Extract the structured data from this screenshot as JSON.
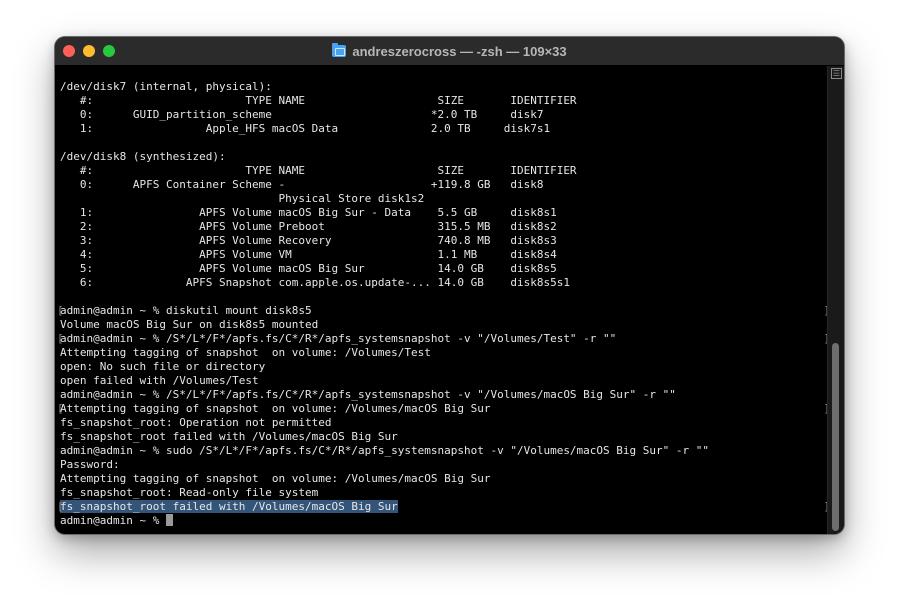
{
  "window": {
    "title": "andreszerocross — -zsh — 109×33"
  },
  "terminal": {
    "lines": [
      {
        "text": "",
        "bracket": false,
        "highlight": false
      },
      {
        "text": "/dev/disk7 (internal, physical):",
        "bracket": false,
        "highlight": false
      },
      {
        "text": "   #:                       TYPE NAME                    SIZE       IDENTIFIER",
        "bracket": false,
        "highlight": false
      },
      {
        "text": "   0:      GUID_partition_scheme                        *2.0 TB     disk7",
        "bracket": false,
        "highlight": false
      },
      {
        "text": "   1:                 Apple_HFS macOS Data              2.0 TB     disk7s1",
        "bracket": false,
        "highlight": false
      },
      {
        "text": "",
        "bracket": false,
        "highlight": false
      },
      {
        "text": "/dev/disk8 (synthesized):",
        "bracket": false,
        "highlight": false
      },
      {
        "text": "   #:                       TYPE NAME                    SIZE       IDENTIFIER",
        "bracket": false,
        "highlight": false
      },
      {
        "text": "   0:      APFS Container Scheme -                      +119.8 GB   disk8",
        "bracket": false,
        "highlight": false
      },
      {
        "text": "                                 Physical Store disk1s2",
        "bracket": false,
        "highlight": false
      },
      {
        "text": "   1:                APFS Volume macOS Big Sur - Data    5.5 GB     disk8s1",
        "bracket": false,
        "highlight": false
      },
      {
        "text": "   2:                APFS Volume Preboot                 315.5 MB   disk8s2",
        "bracket": false,
        "highlight": false
      },
      {
        "text": "   3:                APFS Volume Recovery                740.8 MB   disk8s3",
        "bracket": false,
        "highlight": false
      },
      {
        "text": "   4:                APFS Volume VM                      1.1 MB     disk8s4",
        "bracket": false,
        "highlight": false
      },
      {
        "text": "   5:                APFS Volume macOS Big Sur           14.0 GB    disk8s5",
        "bracket": false,
        "highlight": false
      },
      {
        "text": "   6:              APFS Snapshot com.apple.os.update-... 14.0 GB    disk8s5s1",
        "bracket": false,
        "highlight": false
      },
      {
        "text": "",
        "bracket": false,
        "highlight": false
      },
      {
        "text": "admin@admin ~ % diskutil mount disk8s5",
        "bracket": true,
        "highlight": false
      },
      {
        "text": "Volume macOS Big Sur on disk8s5 mounted",
        "bracket": false,
        "highlight": false
      },
      {
        "text": "admin@admin ~ % /S*/L*/F*/apfs.fs/C*/R*/apfs_systemsnapshot -v \"/Volumes/Test\" -r \"\"",
        "bracket": true,
        "highlight": false
      },
      {
        "text": "Attempting tagging of snapshot  on volume: /Volumes/Test",
        "bracket": false,
        "highlight": false
      },
      {
        "text": "open: No such file or directory",
        "bracket": false,
        "highlight": false
      },
      {
        "text": "open failed with /Volumes/Test",
        "bracket": false,
        "highlight": false
      },
      {
        "text": "admin@admin ~ % /S*/L*/F*/apfs.fs/C*/R*/apfs_systemsnapshot -v \"/Volumes/macOS Big Sur\" -r \"\"",
        "bracket": false,
        "highlight": false
      },
      {
        "text": "Attempting tagging of snapshot  on volume: /Volumes/macOS Big Sur",
        "bracket": true,
        "highlight": false
      },
      {
        "text": "fs_snapshot_root: Operation not permitted",
        "bracket": false,
        "highlight": false
      },
      {
        "text": "fs_snapshot_root failed with /Volumes/macOS Big Sur",
        "bracket": false,
        "highlight": false
      },
      {
        "text": "admin@admin ~ % sudo /S*/L*/F*/apfs.fs/C*/R*/apfs_systemsnapshot -v \"/Volumes/macOS Big Sur\" -r \"\"",
        "bracket": false,
        "highlight": false
      },
      {
        "text": "Password:",
        "bracket": false,
        "highlight": false
      },
      {
        "text": "Attempting tagging of snapshot  on volume: /Volumes/macOS Big Sur",
        "bracket": false,
        "highlight": false
      },
      {
        "text": "fs_snapshot_root: Read-only file system",
        "bracket": false,
        "highlight": false
      },
      {
        "text": "fs_snapshot_root failed with /Volumes/macOS Big Sur",
        "bracket": true,
        "highlight": true
      },
      {
        "text": "admin@admin ~ % ",
        "bracket": false,
        "highlight": false,
        "cursor": true
      }
    ]
  },
  "colors": {
    "background": "#000000",
    "text": "#e6e6e6",
    "selection": "#33557a",
    "close": "#ff5f57",
    "minimize": "#febc2e",
    "maximize": "#28c840"
  }
}
